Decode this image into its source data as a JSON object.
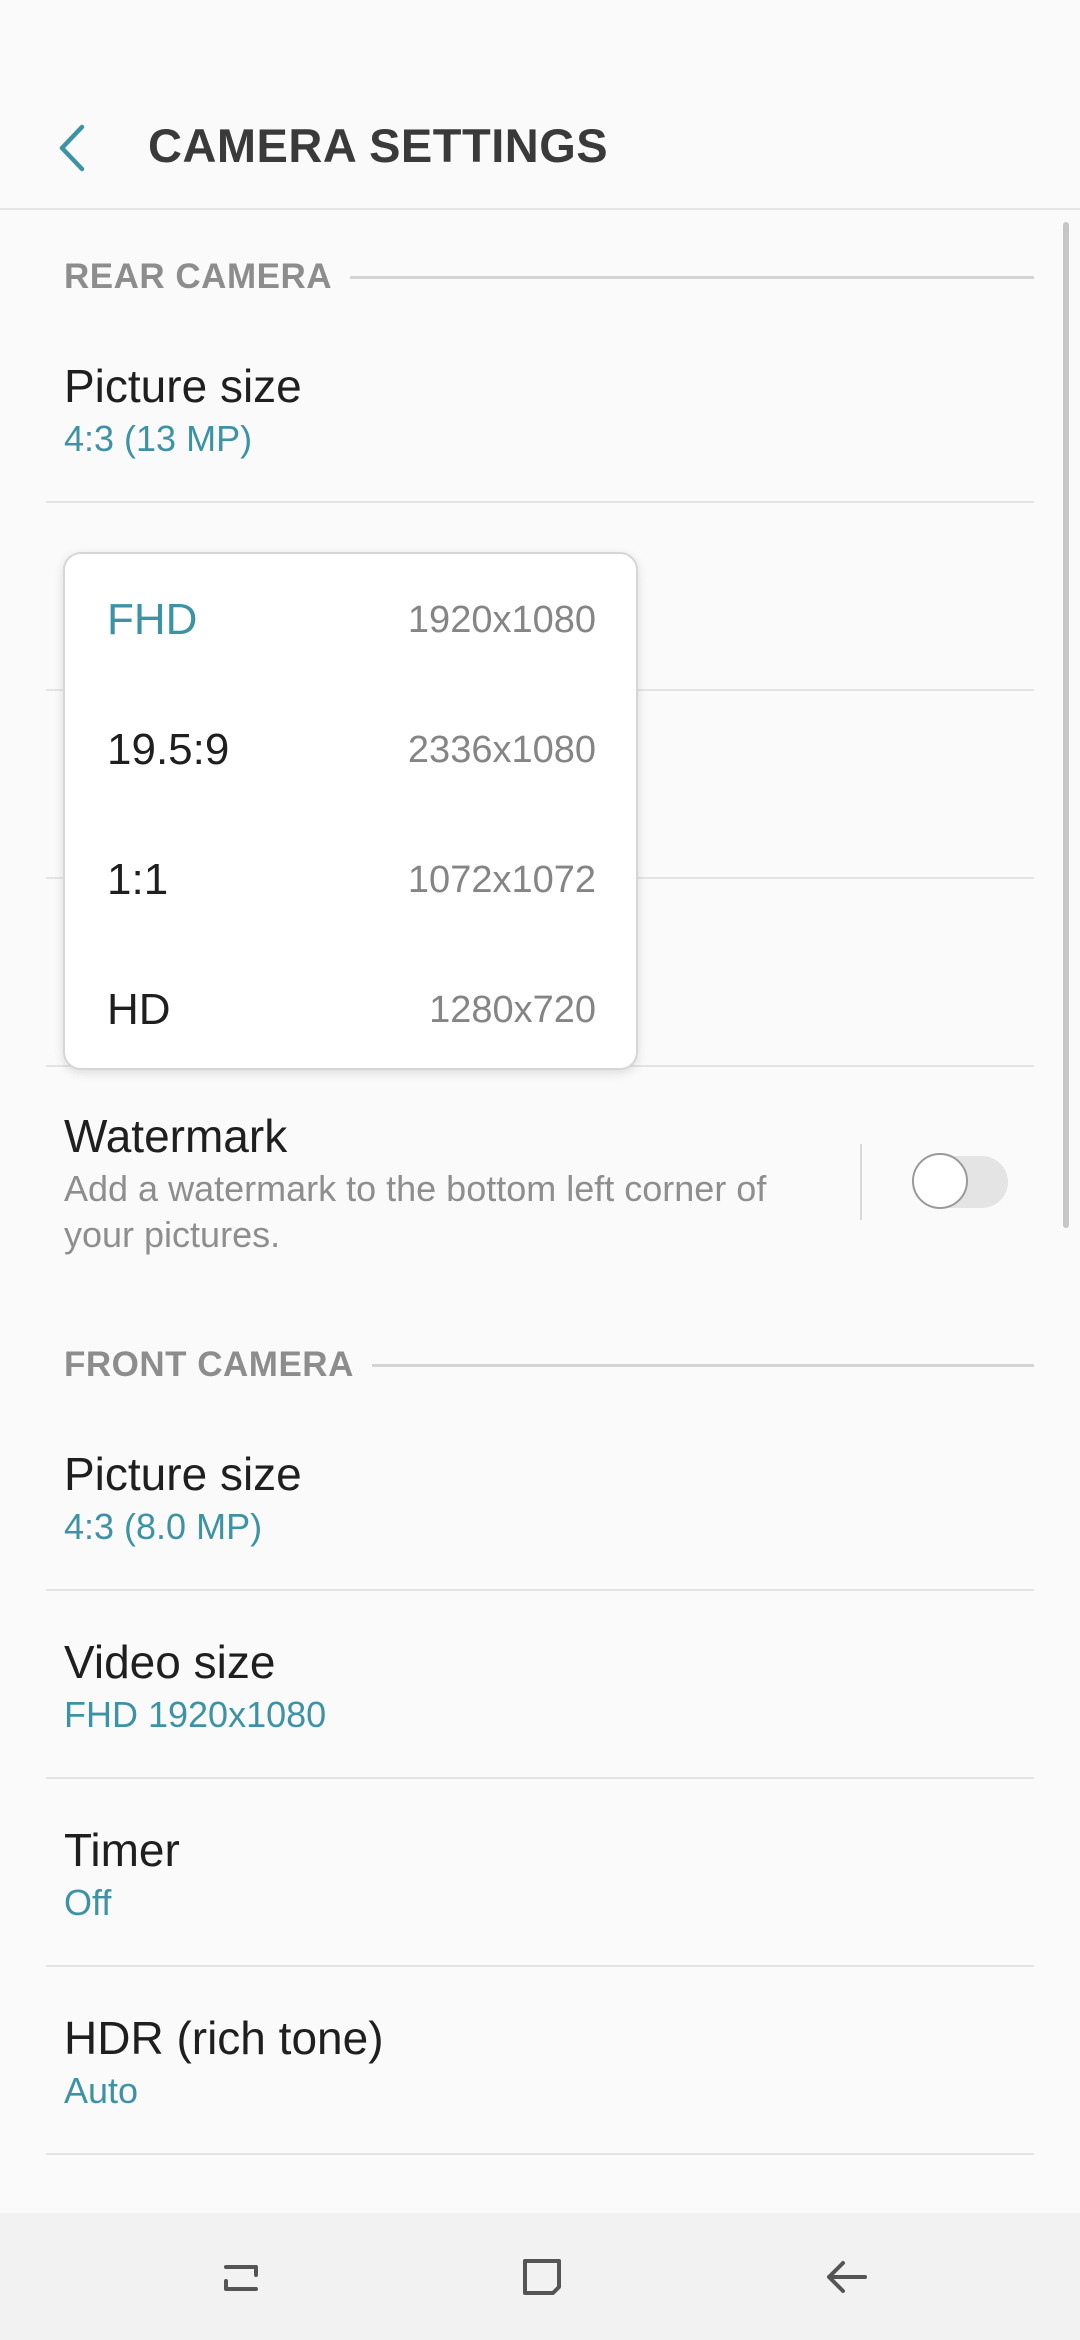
{
  "header": {
    "title": "CAMERA SETTINGS"
  },
  "rear": {
    "section_label": "REAR CAMERA",
    "picture_size": {
      "title": "Picture size",
      "value": "4:3 (13 MP)"
    },
    "watermark": {
      "title": "Watermark",
      "description": "Add a watermark to the bottom left corner of your pictures.",
      "enabled": false
    }
  },
  "video_size_popup": {
    "options": [
      {
        "label": "FHD",
        "resolution": "1920x1080",
        "selected": true
      },
      {
        "label": "19.5:9",
        "resolution": "2336x1080",
        "selected": false
      },
      {
        "label": "1:1",
        "resolution": "1072x1072",
        "selected": false
      },
      {
        "label": "HD",
        "resolution": "1280x720",
        "selected": false
      }
    ]
  },
  "front": {
    "section_label": "FRONT CAMERA",
    "picture_size": {
      "title": "Picture size",
      "value": "4:3 (8.0 MP)"
    },
    "video_size": {
      "title": "Video size",
      "value": "FHD 1920x1080"
    },
    "timer": {
      "title": "Timer",
      "value": "Off"
    },
    "hdr": {
      "title": "HDR (rich tone)",
      "value": "Auto"
    }
  },
  "colors": {
    "accent": "#3d93a5",
    "title": "#3a3a3a",
    "section": "#8d8d8d"
  },
  "navbar": {
    "icons": [
      "recent-apps-icon",
      "home-icon",
      "back-arrow-icon"
    ]
  }
}
